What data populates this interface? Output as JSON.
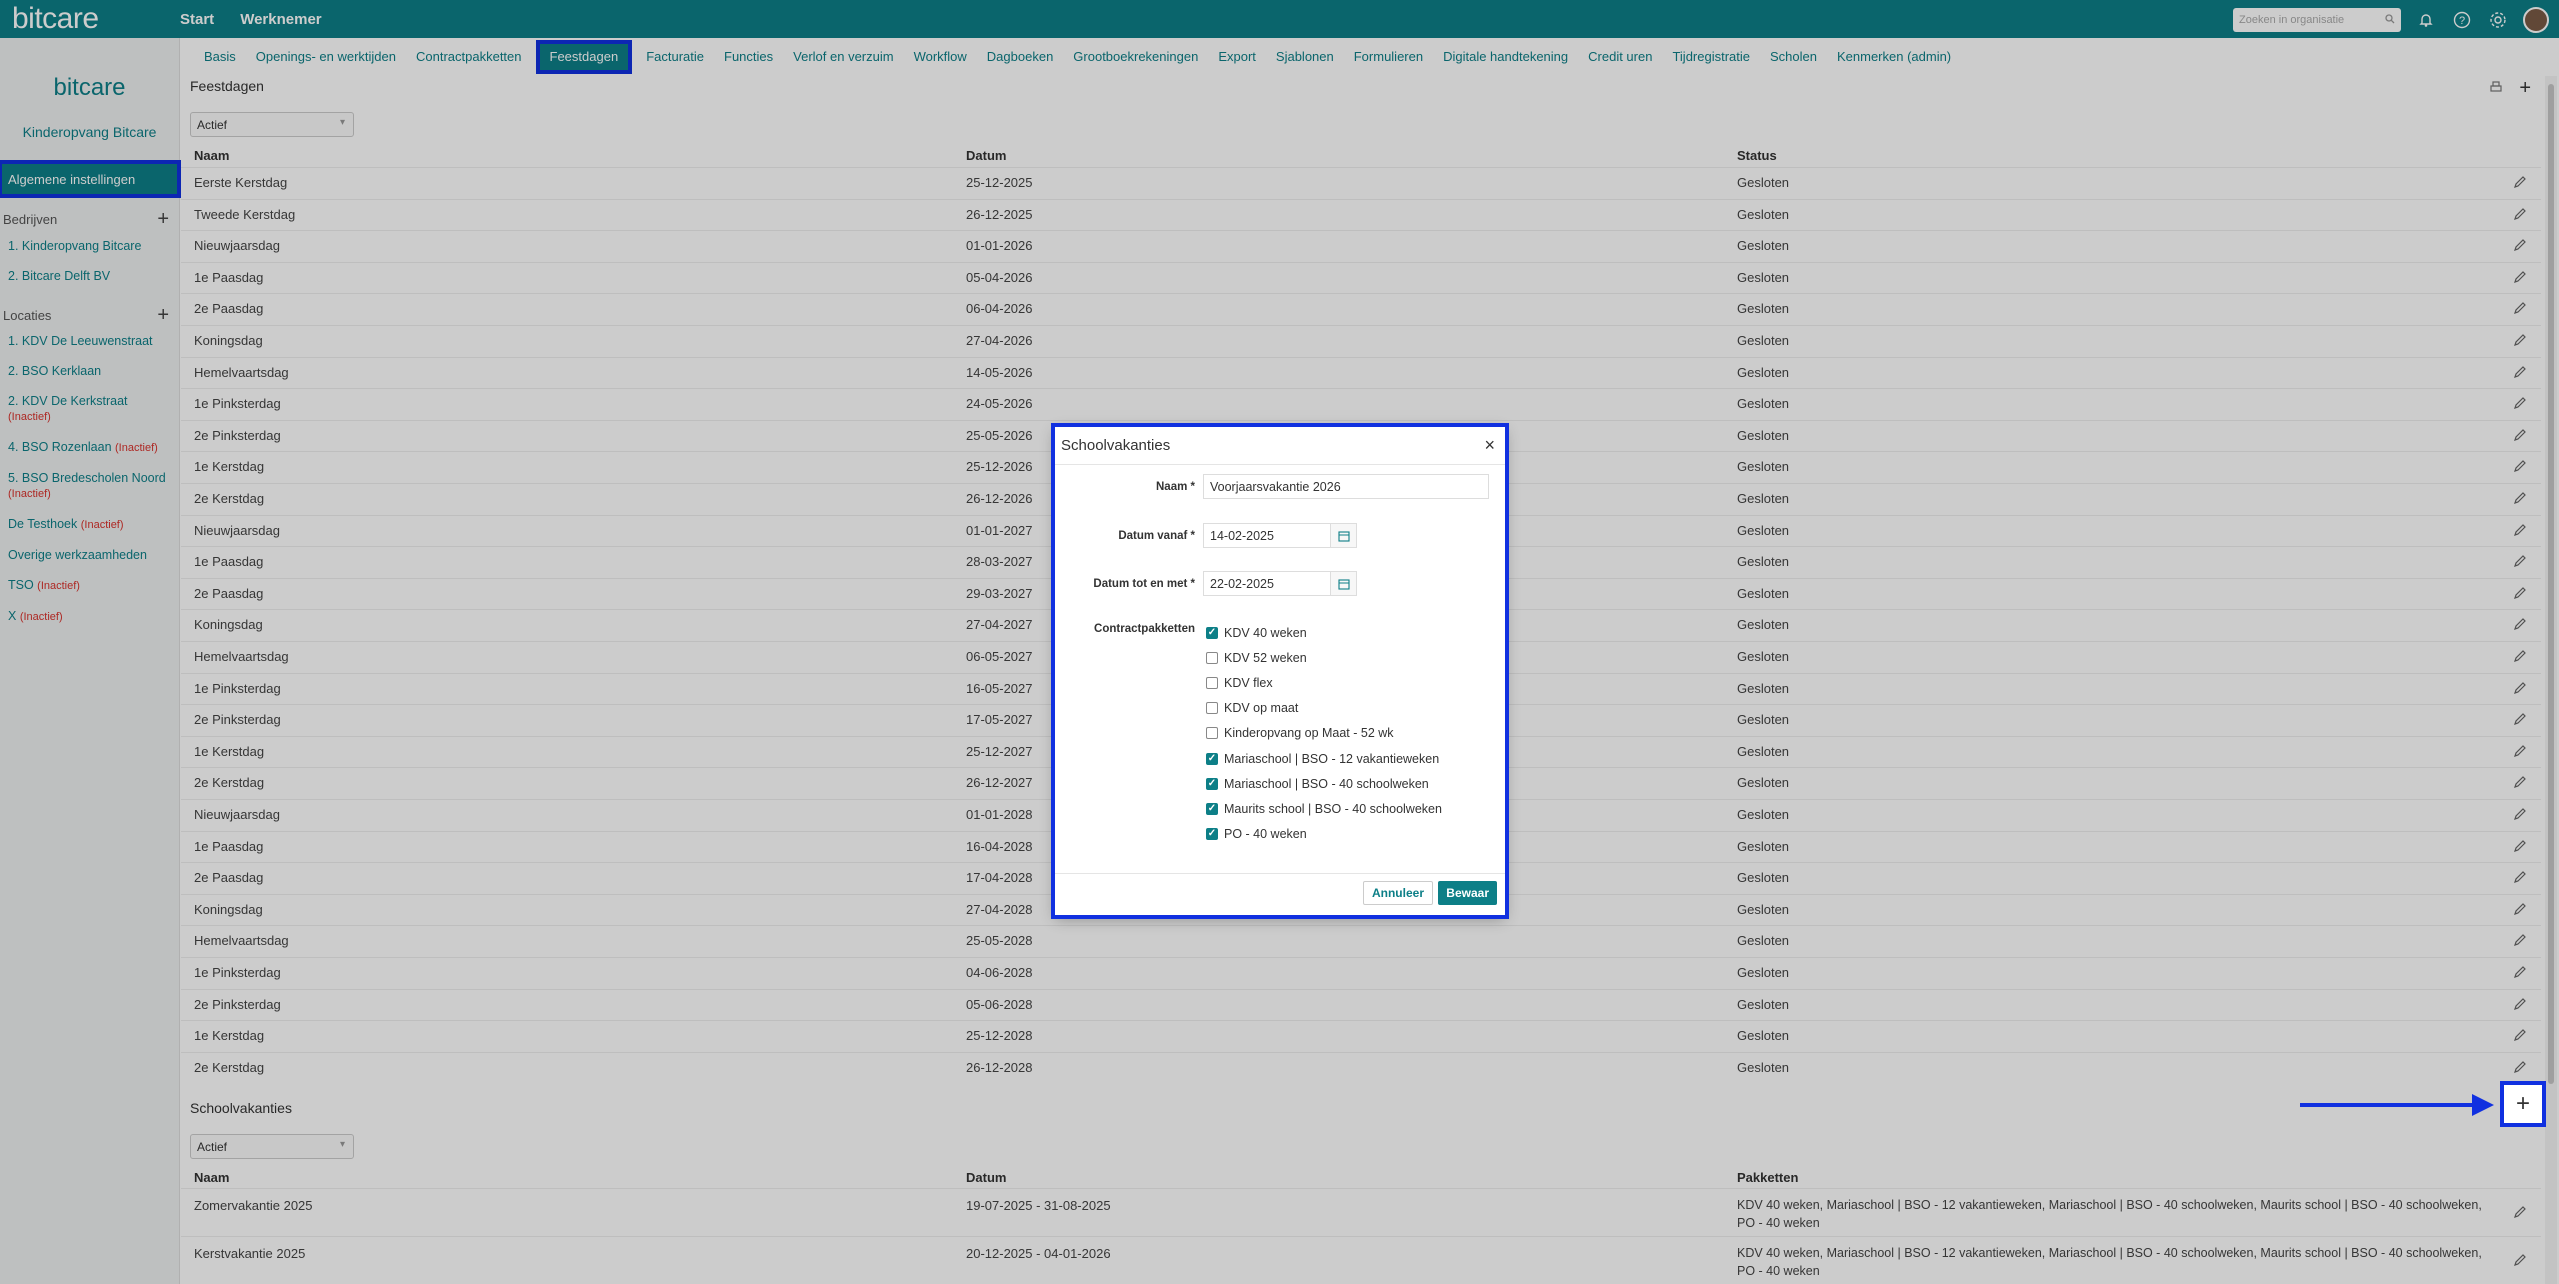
{
  "topbar": {
    "logo": "bitcare",
    "nav": [
      "Start",
      "Werknemer"
    ],
    "search_placeholder": "Zoeken in organisatie"
  },
  "sidebar": {
    "logo": "bitcare",
    "company": "Kinderopvang Bitcare",
    "active_item": "Algemene instellingen",
    "companies_label": "Bedrijven",
    "companies": [
      {
        "label": "1. Kinderopvang Bitcare",
        "inactive": ""
      },
      {
        "label": "2. Bitcare Delft BV",
        "inactive": ""
      }
    ],
    "locations_label": "Locaties",
    "locations": [
      {
        "label": "1. KDV De Leeuwenstraat",
        "inactive": ""
      },
      {
        "label": "2. BSO Kerklaan",
        "inactive": ""
      },
      {
        "label": "2. KDV De Kerkstraat ",
        "inactive": "(Inactief)"
      },
      {
        "label": "4. BSO Rozenlaan ",
        "inactive": "(Inactief)"
      },
      {
        "label": "5. BSO Bredescholen Noord ",
        "inactive": "(Inactief)"
      },
      {
        "label": "De Testhoek ",
        "inactive": "(Inactief)"
      },
      {
        "label": "Overige werkzaamheden",
        "inactive": ""
      },
      {
        "label": "TSO ",
        "inactive": "(Inactief)"
      },
      {
        "label": "X ",
        "inactive": "(Inactief)"
      }
    ]
  },
  "subnav": {
    "tabs": [
      "Basis",
      "Openings- en werktijden",
      "Contractpakketten",
      "Feestdagen",
      "Facturatie",
      "Functies",
      "Verlof en verzuim",
      "Workflow",
      "Dagboeken",
      "Grootboekrekeningen",
      "Export",
      "Sjablonen",
      "Formulieren",
      "Digitale handtekening",
      "Credit uren",
      "Tijdregistratie",
      "Scholen",
      "Kenmerken (admin)"
    ],
    "active": "Feestdagen"
  },
  "feestdagen": {
    "title": "Feestdagen",
    "filter": "Actief",
    "columns": [
      "Naam",
      "Datum",
      "Status"
    ],
    "rows": [
      [
        "Eerste Kerstdag",
        "25-12-2025",
        "Gesloten"
      ],
      [
        "Tweede Kerstdag",
        "26-12-2025",
        "Gesloten"
      ],
      [
        "Nieuwjaarsdag",
        "01-01-2026",
        "Gesloten"
      ],
      [
        "1e Paasdag",
        "05-04-2026",
        "Gesloten"
      ],
      [
        "2e Paasdag",
        "06-04-2026",
        "Gesloten"
      ],
      [
        "Koningsdag",
        "27-04-2026",
        "Gesloten"
      ],
      [
        "Hemelvaartsdag",
        "14-05-2026",
        "Gesloten"
      ],
      [
        "1e Pinksterdag",
        "24-05-2026",
        "Gesloten"
      ],
      [
        "2e Pinksterdag",
        "25-05-2026",
        "Gesloten"
      ],
      [
        "1e Kerstdag",
        "25-12-2026",
        "Gesloten"
      ],
      [
        "2e Kerstdag",
        "26-12-2026",
        "Gesloten"
      ],
      [
        "Nieuwjaarsdag",
        "01-01-2027",
        "Gesloten"
      ],
      [
        "1e Paasdag",
        "28-03-2027",
        "Gesloten"
      ],
      [
        "2e Paasdag",
        "29-03-2027",
        "Gesloten"
      ],
      [
        "Koningsdag",
        "27-04-2027",
        "Gesloten"
      ],
      [
        "Hemelvaartsdag",
        "06-05-2027",
        "Gesloten"
      ],
      [
        "1e Pinksterdag",
        "16-05-2027",
        "Gesloten"
      ],
      [
        "2e Pinksterdag",
        "17-05-2027",
        "Gesloten"
      ],
      [
        "1e Kerstdag",
        "25-12-2027",
        "Gesloten"
      ],
      [
        "2e Kerstdag",
        "26-12-2027",
        "Gesloten"
      ],
      [
        "Nieuwjaarsdag",
        "01-01-2028",
        "Gesloten"
      ],
      [
        "1e Paasdag",
        "16-04-2028",
        "Gesloten"
      ],
      [
        "2e Paasdag",
        "17-04-2028",
        "Gesloten"
      ],
      [
        "Koningsdag",
        "27-04-2028",
        "Gesloten"
      ],
      [
        "Hemelvaartsdag",
        "25-05-2028",
        "Gesloten"
      ],
      [
        "1e Pinksterdag",
        "04-06-2028",
        "Gesloten"
      ],
      [
        "2e Pinksterdag",
        "05-06-2028",
        "Gesloten"
      ],
      [
        "1e Kerstdag",
        "25-12-2028",
        "Gesloten"
      ],
      [
        "2e Kerstdag",
        "26-12-2028",
        "Gesloten"
      ]
    ]
  },
  "schoolvakanties": {
    "title": "Schoolvakanties",
    "filter": "Actief",
    "columns": [
      "Naam",
      "Datum",
      "Pakketten"
    ],
    "rows": [
      [
        "Zomervakantie 2025",
        "19-07-2025 - 31-08-2025",
        "KDV 40 weken, Mariaschool | BSO - 12 vakantieweken, Mariaschool | BSO - 40 schoolweken, Maurits school | BSO - 40 schoolweken,",
        "PO - 40 weken"
      ],
      [
        "Kerstvakantie 2025",
        "20-12-2025 - 04-01-2026",
        "KDV 40 weken, Mariaschool | BSO - 12 vakantieweken, Mariaschool | BSO - 40 schoolweken, Maurits school | BSO - 40 schoolweken,",
        "PO - 40 weken"
      ]
    ]
  },
  "modal": {
    "title": "Schoolvakanties",
    "close": "×",
    "naam_label": "Naam *",
    "naam_value": "Voorjaarsvakantie 2026",
    "vanaf_label": "Datum vanaf *",
    "vanaf_value": "14-02-2025",
    "tot_label": "Datum tot en met *",
    "tot_value": "22-02-2025",
    "pakketten_label": "Contractpakketten",
    "pakketten": [
      {
        "label": "KDV 40 weken",
        "checked": true
      },
      {
        "label": "KDV 52 weken",
        "checked": false
      },
      {
        "label": "KDV flex",
        "checked": false
      },
      {
        "label": "KDV op maat",
        "checked": false
      },
      {
        "label": "Kinderopvang op Maat - 52 wk",
        "checked": false
      },
      {
        "label": "Mariaschool | BSO - 12 vakantieweken",
        "checked": true
      },
      {
        "label": "Mariaschool | BSO - 40 schoolweken",
        "checked": true
      },
      {
        "label": "Maurits school | BSO - 40 schoolweken",
        "checked": true
      },
      {
        "label": "PO - 40 weken",
        "checked": true
      }
    ],
    "cancel_label": "Annuleer",
    "save_label": "Bewaar"
  },
  "colors": {
    "brand": "#0d7f87",
    "highlight": "#1030e0",
    "inactive": "#d9322c"
  }
}
